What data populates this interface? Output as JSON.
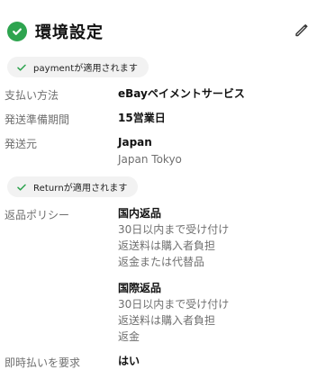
{
  "section": {
    "title": "環境設定"
  },
  "payment_pill": {
    "text": "paymentが適用されます"
  },
  "payment_method": {
    "label": "支払い方法",
    "value": "eBayペイメントサービス"
  },
  "handling_time": {
    "label": "発送準備期間",
    "value": "15営業日"
  },
  "ship_from": {
    "label": "発送元",
    "country": "Japan",
    "city": "Japan Tokyo"
  },
  "return_pill": {
    "text": "Returnが適用されます"
  },
  "return_policy": {
    "label": "返品ポリシー",
    "domestic": {
      "title": "国内返品",
      "window": "30日以内まで受け付け",
      "shipping": "返送料は購入者負担",
      "refund": "返金または代替品"
    },
    "international": {
      "title": "国際返品",
      "window": "30日以内まで受け付け",
      "shipping": "返送料は購入者負担",
      "refund": "返金"
    }
  },
  "immediate_payment": {
    "label": "即時払いを要求",
    "value": "はい"
  },
  "icons": {
    "section_check": "check-circle-icon",
    "edit": "pencil-icon",
    "pill_check": "check-icon"
  },
  "colors": {
    "accent_green": "#2ea44f",
    "pill_background": "#f2f2f2",
    "label_gray": "#6f6f6f"
  }
}
